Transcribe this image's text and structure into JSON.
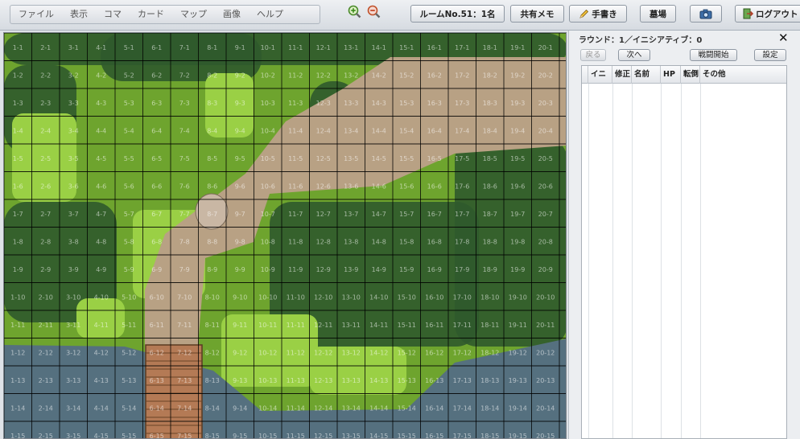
{
  "menu": {
    "items": [
      "ファイル",
      "表示",
      "コマ",
      "カード",
      "マップ",
      "画像",
      "ヘルプ"
    ]
  },
  "toolbar": {
    "room_label": "ルームNo.51：1名",
    "shared_memo_label": "共有メモ",
    "handwriting_label": "手書き",
    "graveyard_label": "墓場",
    "logout_label": "ログアウト"
  },
  "map": {
    "cols": 20,
    "rows": 15
  },
  "initiative": {
    "round_label": "ラウンド：1／イニシアティブ：0",
    "close_glyph": "✕",
    "back_label": "戻る",
    "next_label": "次へ",
    "start_label": "戦闘開始",
    "settings_label": "設定",
    "columns": [
      "",
      "イニ",
      "修正",
      "名前",
      "HP",
      "転倒",
      "その他"
    ]
  },
  "icons": [
    "zoom-in-icon",
    "zoom-out-icon",
    "pencil-icon",
    "camera-icon",
    "logout-icon"
  ],
  "colors": {
    "grass": "#6ea42e",
    "bright_grass": "#9ad045",
    "path": "#b8a184",
    "forest": "#2f5a2c",
    "water": "#55707f"
  }
}
